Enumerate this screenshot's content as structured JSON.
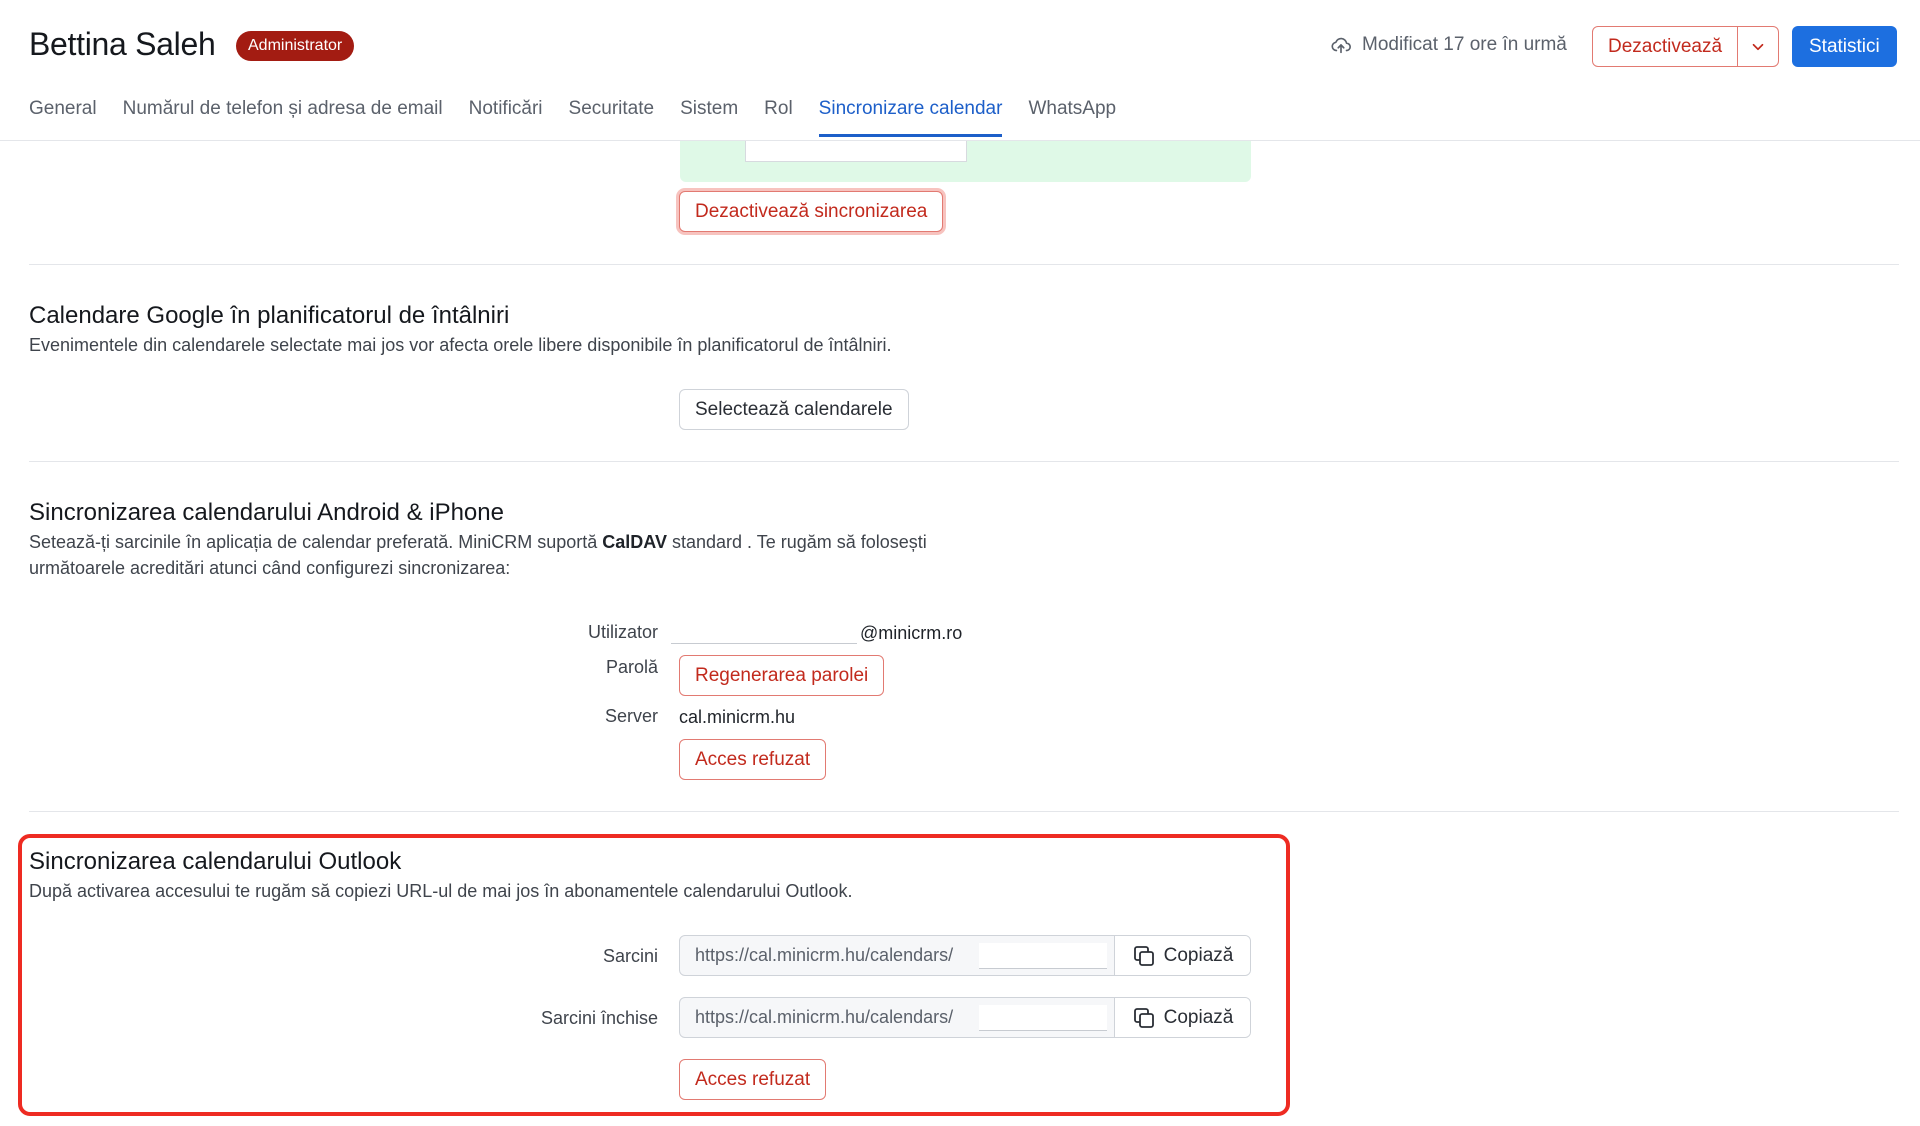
{
  "header": {
    "user_name": "Bettina Saleh",
    "role_badge": "Administrator",
    "modified": "Modificat 17 ore în urmă",
    "deactivate_label": "Dezactivează",
    "stats_label": "Statistici",
    "colors": {
      "accent": "#1d6fe0",
      "danger": "#c22a1d",
      "badge": "#a31c12"
    }
  },
  "tabs": [
    {
      "label": "General"
    },
    {
      "label": "Numărul de telefon și adresa de email"
    },
    {
      "label": "Notificări"
    },
    {
      "label": "Securitate"
    },
    {
      "label": "Sistem"
    },
    {
      "label": "Rol"
    },
    {
      "label": "Sincronizare calendar",
      "active": true
    },
    {
      "label": "WhatsApp"
    }
  ],
  "google_sync": {
    "disable_sync_label": "Dezactivează sincronizarea"
  },
  "google_calendars": {
    "title": "Calendare Google în planificatorul de întâlniri",
    "description": "Evenimentele din calendarele selectate mai jos vor afecta orele libere disponibile în planificatorul de întâlniri.",
    "select_label": "Selectează calendarele"
  },
  "android_iphone": {
    "title": "Sincronizarea calendarului Android & iPhone",
    "desc_part1": "Setează-ți sarcinile în aplicația de calendar preferată. MiniCRM suportă ",
    "desc_bold": "CalDAV",
    "desc_part2": " standard . Te rugăm să folosești următoarele acreditări atunci când configurezi sincronizarea:",
    "user_label": "Utilizator",
    "user_suffix": "@minicrm.ro",
    "password_label": "Parolă",
    "regen_password_label": "Regenerarea parolei",
    "server_label": "Server",
    "server_value": "cal.minicrm.hu",
    "access_denied_label": "Acces refuzat"
  },
  "outlook": {
    "title": "Sincronizarea calendarului Outlook",
    "description": "După activarea accesului te rugăm să copiezi URL-ul de mai jos în abonamentele calendarului Outlook.",
    "tasks_label": "Sarcini",
    "tasks_url": "https://cal.minicrm.hu/calendars/",
    "closed_tasks_label": "Sarcini închise",
    "closed_tasks_url": "https://cal.minicrm.hu/calendars/",
    "copy_label": "Copiază",
    "access_denied_label": "Acces refuzat"
  }
}
